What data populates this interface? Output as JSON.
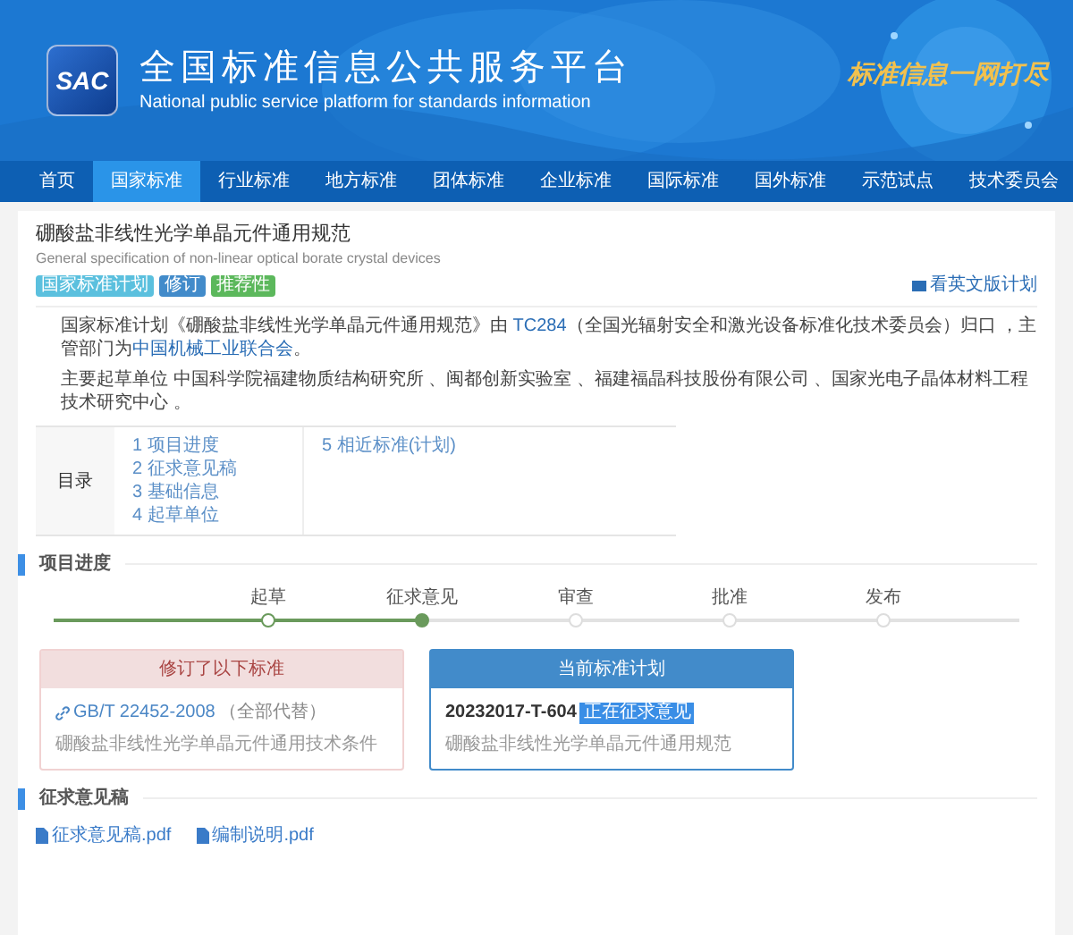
{
  "header": {
    "logo": "SAC",
    "title": "全国标准信息公共服务平台",
    "subtitle": "National public service platform  for standards information",
    "slogan": "标准信息一网打尽"
  },
  "nav": [
    {
      "label": "首页",
      "selected": false
    },
    {
      "label": "国家标准",
      "selected": true
    },
    {
      "label": "行业标准",
      "selected": false
    },
    {
      "label": "地方标准",
      "selected": false
    },
    {
      "label": "团体标准",
      "selected": false
    },
    {
      "label": "企业标准",
      "selected": false
    },
    {
      "label": "国际标准",
      "selected": false
    },
    {
      "label": "国外标准",
      "selected": false
    },
    {
      "label": "示范试点",
      "selected": false
    },
    {
      "label": "技术委员会",
      "selected": false
    }
  ],
  "standard": {
    "title": "硼酸盐非线性光学单晶元件通用规范",
    "english_title": "General specification of non-linear optical borate crystal devices",
    "tags": [
      {
        "label": "国家标准计划",
        "color": "#5bc0de"
      },
      {
        "label": "修订",
        "color": "#428bca"
      },
      {
        "label": "推荐性",
        "color": "#5cb85c"
      }
    ],
    "english_link": "看英文版计划",
    "description": [
      {
        "parts": [
          {
            "text": "国家标准计划《硼酸盐非线性光学单晶元件通用规范》由 ",
            "link": false
          },
          {
            "text": "TC284",
            "link": true
          },
          {
            "text": "（全国光辐射安全和激光设备标准化技术委员会）归口 ，主管部门为",
            "link": false
          },
          {
            "text": "中国机械工业联合会",
            "link": true
          },
          {
            "text": "。",
            "link": false
          }
        ]
      },
      {
        "parts": [
          {
            "text": "主要起草单位 中国科学院福建物质结构研究所 、闽都创新实验室 、福建福晶科技股份有限公司 、国家光电子晶体材料工程技术研究中心 。",
            "link": false
          }
        ]
      }
    ]
  },
  "toc": {
    "label": "目录",
    "columns": [
      [
        "1 项目进度",
        "2 征求意见稿",
        "3 基础信息",
        "4 起草单位"
      ],
      [
        "5 相近标准(计划)"
      ]
    ]
  },
  "progress": {
    "title": "项目进度",
    "steps": [
      {
        "label": "起草",
        "reached": true,
        "current": false
      },
      {
        "label": "征求意见",
        "reached": true,
        "current": true
      },
      {
        "label": "审查",
        "reached": false,
        "current": false
      },
      {
        "label": "批准",
        "reached": false,
        "current": false
      },
      {
        "label": "发布",
        "reached": false,
        "current": false
      }
    ]
  },
  "cards": [
    {
      "kind": "revised",
      "header": "修订了以下标准",
      "code": "GB/T 22452-2008",
      "note": "（全部代替）",
      "description": "硼酸盐非线性光学单晶元件通用技术条件"
    },
    {
      "kind": "current",
      "header": "当前标准计划",
      "code": "20232017-T-604",
      "badge": "正在征求意见",
      "description": "硼酸盐非线性光学单晶元件通用规范"
    }
  ],
  "drafts": {
    "title": "征求意见稿",
    "files": [
      "征求意见稿.pdf",
      "编制说明.pdf"
    ]
  }
}
